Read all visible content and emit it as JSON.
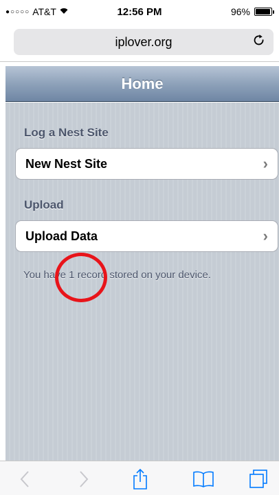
{
  "status_bar": {
    "carrier": "AT&T",
    "signal_icon": "signal-dots-icon",
    "wifi_icon": "wifi-icon",
    "time": "12:56 PM",
    "battery_percent": "96%",
    "battery_level": 0.96
  },
  "browser": {
    "url": "iplover.org",
    "reload_icon": "reload-icon"
  },
  "header": {
    "title": "Home"
  },
  "sections": [
    {
      "label": "Log a Nest Site",
      "row_label": "New Nest Site",
      "icon": "chevron-right-icon"
    },
    {
      "label": "Upload",
      "row_label": "Upload Data",
      "icon": "chevron-right-icon"
    }
  ],
  "info_text": "You have 1 record stored on your device.",
  "annotation": {
    "color": "#e8141a"
  },
  "toolbar": {
    "buttons": [
      "back-icon",
      "forward-icon",
      "share-icon",
      "bookmarks-icon",
      "tabs-icon"
    ]
  },
  "colors": {
    "accent": "#007aff",
    "disabled": "#c7c7cc",
    "header_gradient_mid": "#8ea2ba",
    "section_label": "#4c566c"
  }
}
